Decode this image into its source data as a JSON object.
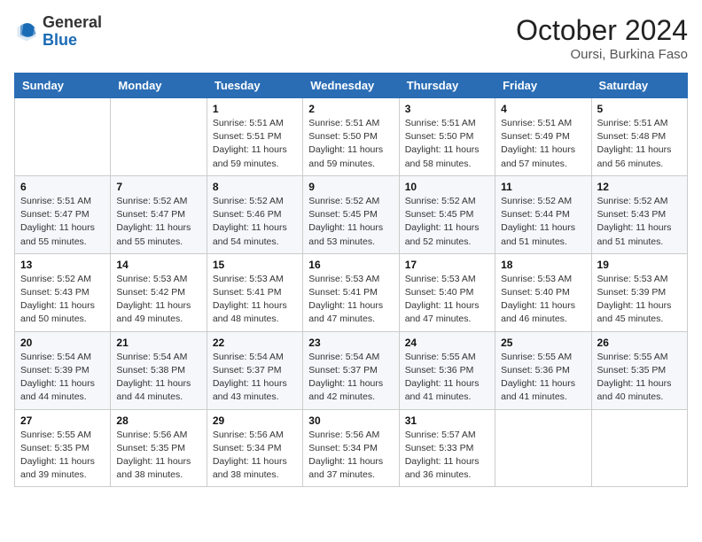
{
  "header": {
    "logo_general": "General",
    "logo_blue": "Blue",
    "month": "October 2024",
    "location": "Oursi, Burkina Faso"
  },
  "weekdays": [
    "Sunday",
    "Monday",
    "Tuesday",
    "Wednesday",
    "Thursday",
    "Friday",
    "Saturday"
  ],
  "weeks": [
    [
      {
        "day": "",
        "sunrise": "",
        "sunset": "",
        "daylight": ""
      },
      {
        "day": "",
        "sunrise": "",
        "sunset": "",
        "daylight": ""
      },
      {
        "day": "1",
        "sunrise": "Sunrise: 5:51 AM",
        "sunset": "Sunset: 5:51 PM",
        "daylight": "Daylight: 11 hours and 59 minutes."
      },
      {
        "day": "2",
        "sunrise": "Sunrise: 5:51 AM",
        "sunset": "Sunset: 5:50 PM",
        "daylight": "Daylight: 11 hours and 59 minutes."
      },
      {
        "day": "3",
        "sunrise": "Sunrise: 5:51 AM",
        "sunset": "Sunset: 5:50 PM",
        "daylight": "Daylight: 11 hours and 58 minutes."
      },
      {
        "day": "4",
        "sunrise": "Sunrise: 5:51 AM",
        "sunset": "Sunset: 5:49 PM",
        "daylight": "Daylight: 11 hours and 57 minutes."
      },
      {
        "day": "5",
        "sunrise": "Sunrise: 5:51 AM",
        "sunset": "Sunset: 5:48 PM",
        "daylight": "Daylight: 11 hours and 56 minutes."
      }
    ],
    [
      {
        "day": "6",
        "sunrise": "Sunrise: 5:51 AM",
        "sunset": "Sunset: 5:47 PM",
        "daylight": "Daylight: 11 hours and 55 minutes."
      },
      {
        "day": "7",
        "sunrise": "Sunrise: 5:52 AM",
        "sunset": "Sunset: 5:47 PM",
        "daylight": "Daylight: 11 hours and 55 minutes."
      },
      {
        "day": "8",
        "sunrise": "Sunrise: 5:52 AM",
        "sunset": "Sunset: 5:46 PM",
        "daylight": "Daylight: 11 hours and 54 minutes."
      },
      {
        "day": "9",
        "sunrise": "Sunrise: 5:52 AM",
        "sunset": "Sunset: 5:45 PM",
        "daylight": "Daylight: 11 hours and 53 minutes."
      },
      {
        "day": "10",
        "sunrise": "Sunrise: 5:52 AM",
        "sunset": "Sunset: 5:45 PM",
        "daylight": "Daylight: 11 hours and 52 minutes."
      },
      {
        "day": "11",
        "sunrise": "Sunrise: 5:52 AM",
        "sunset": "Sunset: 5:44 PM",
        "daylight": "Daylight: 11 hours and 51 minutes."
      },
      {
        "day": "12",
        "sunrise": "Sunrise: 5:52 AM",
        "sunset": "Sunset: 5:43 PM",
        "daylight": "Daylight: 11 hours and 51 minutes."
      }
    ],
    [
      {
        "day": "13",
        "sunrise": "Sunrise: 5:52 AM",
        "sunset": "Sunset: 5:43 PM",
        "daylight": "Daylight: 11 hours and 50 minutes."
      },
      {
        "day": "14",
        "sunrise": "Sunrise: 5:53 AM",
        "sunset": "Sunset: 5:42 PM",
        "daylight": "Daylight: 11 hours and 49 minutes."
      },
      {
        "day": "15",
        "sunrise": "Sunrise: 5:53 AM",
        "sunset": "Sunset: 5:41 PM",
        "daylight": "Daylight: 11 hours and 48 minutes."
      },
      {
        "day": "16",
        "sunrise": "Sunrise: 5:53 AM",
        "sunset": "Sunset: 5:41 PM",
        "daylight": "Daylight: 11 hours and 47 minutes."
      },
      {
        "day": "17",
        "sunrise": "Sunrise: 5:53 AM",
        "sunset": "Sunset: 5:40 PM",
        "daylight": "Daylight: 11 hours and 47 minutes."
      },
      {
        "day": "18",
        "sunrise": "Sunrise: 5:53 AM",
        "sunset": "Sunset: 5:40 PM",
        "daylight": "Daylight: 11 hours and 46 minutes."
      },
      {
        "day": "19",
        "sunrise": "Sunrise: 5:53 AM",
        "sunset": "Sunset: 5:39 PM",
        "daylight": "Daylight: 11 hours and 45 minutes."
      }
    ],
    [
      {
        "day": "20",
        "sunrise": "Sunrise: 5:54 AM",
        "sunset": "Sunset: 5:39 PM",
        "daylight": "Daylight: 11 hours and 44 minutes."
      },
      {
        "day": "21",
        "sunrise": "Sunrise: 5:54 AM",
        "sunset": "Sunset: 5:38 PM",
        "daylight": "Daylight: 11 hours and 44 minutes."
      },
      {
        "day": "22",
        "sunrise": "Sunrise: 5:54 AM",
        "sunset": "Sunset: 5:37 PM",
        "daylight": "Daylight: 11 hours and 43 minutes."
      },
      {
        "day": "23",
        "sunrise": "Sunrise: 5:54 AM",
        "sunset": "Sunset: 5:37 PM",
        "daylight": "Daylight: 11 hours and 42 minutes."
      },
      {
        "day": "24",
        "sunrise": "Sunrise: 5:55 AM",
        "sunset": "Sunset: 5:36 PM",
        "daylight": "Daylight: 11 hours and 41 minutes."
      },
      {
        "day": "25",
        "sunrise": "Sunrise: 5:55 AM",
        "sunset": "Sunset: 5:36 PM",
        "daylight": "Daylight: 11 hours and 41 minutes."
      },
      {
        "day": "26",
        "sunrise": "Sunrise: 5:55 AM",
        "sunset": "Sunset: 5:35 PM",
        "daylight": "Daylight: 11 hours and 40 minutes."
      }
    ],
    [
      {
        "day": "27",
        "sunrise": "Sunrise: 5:55 AM",
        "sunset": "Sunset: 5:35 PM",
        "daylight": "Daylight: 11 hours and 39 minutes."
      },
      {
        "day": "28",
        "sunrise": "Sunrise: 5:56 AM",
        "sunset": "Sunset: 5:35 PM",
        "daylight": "Daylight: 11 hours and 38 minutes."
      },
      {
        "day": "29",
        "sunrise": "Sunrise: 5:56 AM",
        "sunset": "Sunset: 5:34 PM",
        "daylight": "Daylight: 11 hours and 38 minutes."
      },
      {
        "day": "30",
        "sunrise": "Sunrise: 5:56 AM",
        "sunset": "Sunset: 5:34 PM",
        "daylight": "Daylight: 11 hours and 37 minutes."
      },
      {
        "day": "31",
        "sunrise": "Sunrise: 5:57 AM",
        "sunset": "Sunset: 5:33 PM",
        "daylight": "Daylight: 11 hours and 36 minutes."
      },
      {
        "day": "",
        "sunrise": "",
        "sunset": "",
        "daylight": ""
      },
      {
        "day": "",
        "sunrise": "",
        "sunset": "",
        "daylight": ""
      }
    ]
  ]
}
